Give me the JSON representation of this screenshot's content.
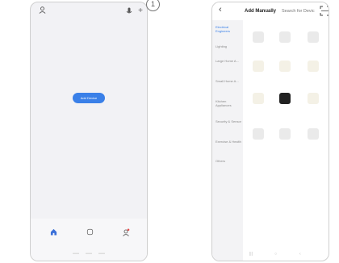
{
  "left_screen": {
    "empty_state": {
      "line1": "",
      "line2": "",
      "button_label": "Add Device"
    },
    "tabbar": [
      {
        "name": "home",
        "label": "",
        "icon": "home-icon"
      },
      {
        "name": "smart",
        "label": "",
        "icon": "smart-scene-icon"
      },
      {
        "name": "me",
        "label": "",
        "icon": "me-icon"
      }
    ],
    "callout_number": "1"
  },
  "right_screen": {
    "header": {
      "back_icon": "chevron-left-icon",
      "tab_manual": "Add Manually",
      "tab_search": "Search for Devic",
      "scan_icon": "scan-icon"
    },
    "categories": [
      {
        "label": "Electrical Engineers",
        "active": true
      },
      {
        "label": "Lighting",
        "active": false
      },
      {
        "label": "Large Home A...",
        "active": false
      },
      {
        "label": "Small Home A...",
        "active": false
      },
      {
        "label": "Kitchen Appliances",
        "active": false
      },
      {
        "label": "Security & Sensor",
        "active": false
      },
      {
        "label": "Exercise & Health",
        "active": false
      },
      {
        "label": "Others",
        "active": false
      }
    ],
    "devices": [
      {
        "label": ""
      },
      {
        "label": ""
      },
      {
        "label": ""
      },
      {
        "label": ""
      },
      {
        "label": ""
      },
      {
        "label": ""
      },
      {
        "label": ""
      },
      {
        "label": ""
      },
      {
        "label": ""
      },
      {
        "label": ""
      },
      {
        "label": ""
      },
      {
        "label": ""
      }
    ]
  }
}
